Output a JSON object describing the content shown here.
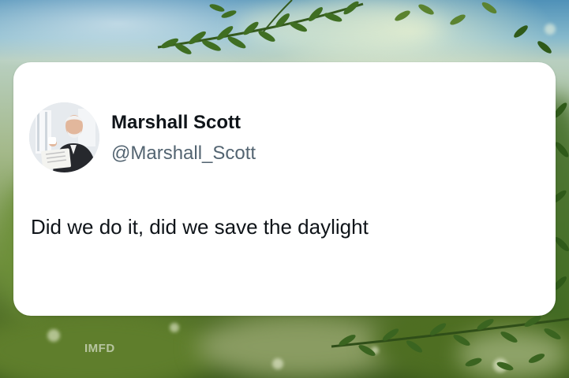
{
  "tweet": {
    "display_name": "Marshall Scott",
    "handle": "@Marshall_Scott",
    "text": "Did we do it, did we save the daylight"
  },
  "watermark": {
    "text": "IMFD"
  },
  "colors": {
    "card_background": "#ffffff",
    "name_text": "#0f1419",
    "handle_text": "#536471",
    "body_text": "#0f1419"
  },
  "icons": {
    "avatar": "profile-photo"
  }
}
